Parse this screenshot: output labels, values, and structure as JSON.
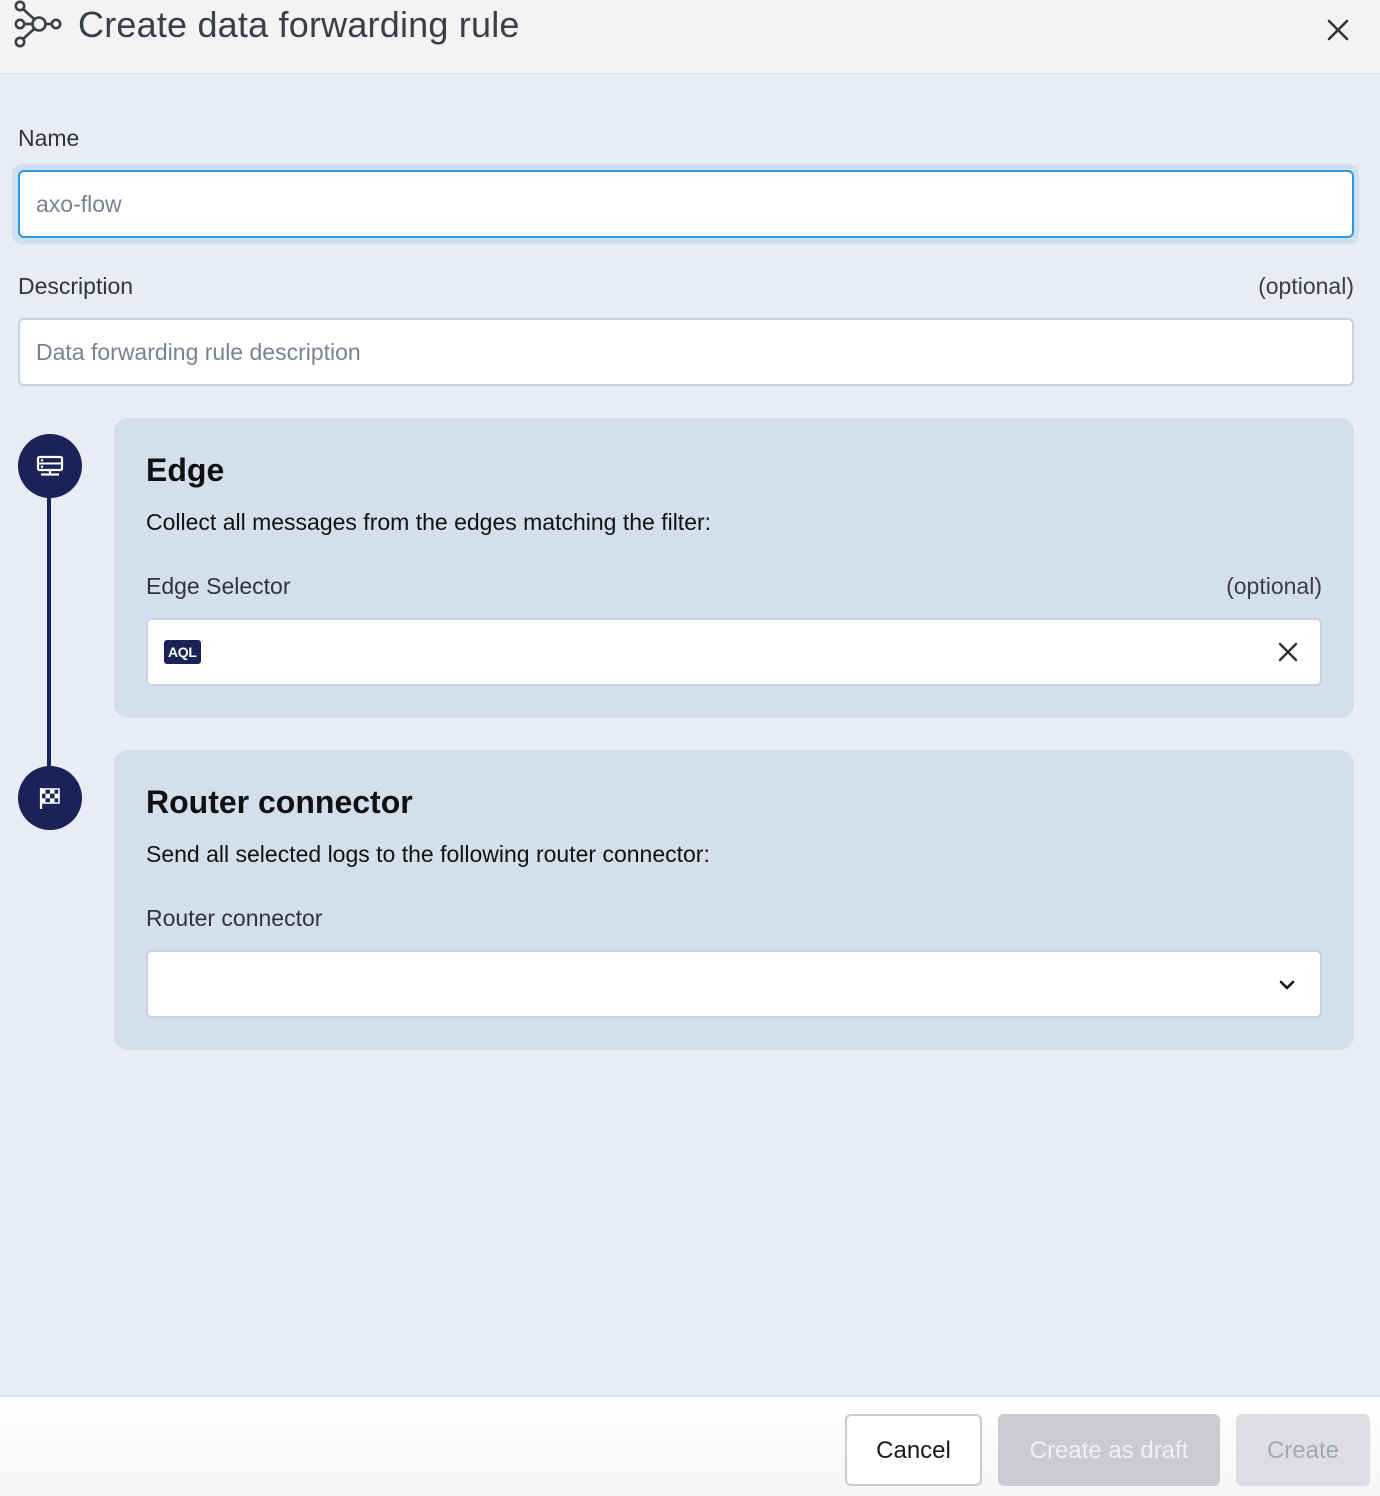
{
  "dialog": {
    "title": "Create data forwarding rule",
    "icon": "flow-nodes-icon",
    "close_icon": "close-icon"
  },
  "form": {
    "name_label": "Name",
    "name_value": "",
    "name_placeholder": "axo-flow",
    "description_label": "Description",
    "description_optional": "(optional)",
    "description_value": "",
    "description_placeholder": "Data forwarding rule description"
  },
  "steps": [
    {
      "icon": "edge-server-icon",
      "title": "Edge",
      "description": "Collect all messages from the edges matching the filter:",
      "field_label": "Edge Selector",
      "field_optional": "(optional)",
      "badge": "AQL",
      "value": ""
    },
    {
      "icon": "checkered-flag-icon",
      "title": "Router connector",
      "description": "Send all selected logs to the following router connector:",
      "field_label": "Router connector",
      "selected": ""
    }
  ],
  "footer": {
    "cancel_label": "Cancel",
    "draft_label": "Create as draft",
    "create_label": "Create"
  },
  "colors": {
    "accent": "#2b9ad8",
    "navy": "#1a2257",
    "page_bg": "#e8ecf4",
    "card_bg": "#d3dfeb"
  }
}
